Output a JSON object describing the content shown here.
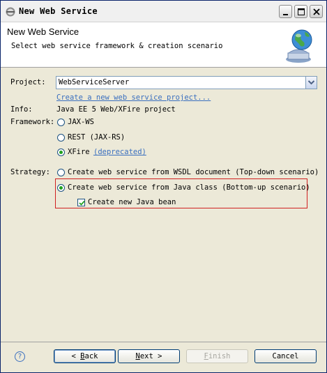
{
  "window": {
    "title": "New Web Service"
  },
  "header": {
    "title": "New Web Service",
    "description": "Select web service framework & creation scenario"
  },
  "form": {
    "project_label": "Project:",
    "project_value": "WebServiceServer",
    "create_project_link": "Create a new web service project...",
    "info_label": "Info:",
    "info_value": "Java EE 5 Web/XFire project",
    "framework_label": "Framework:",
    "frameworks": [
      {
        "label": "JAX-WS",
        "checked": false
      },
      {
        "label": "REST (JAX-RS)",
        "checked": false
      },
      {
        "label": "XFire",
        "checked": true,
        "note": "(deprecated)"
      }
    ],
    "strategy_label": "Strategy:",
    "strategies": [
      {
        "label": "Create web service from WSDL document (Top-down scenario)",
        "checked": false
      },
      {
        "label": "Create web service from Java class (Bottom-up scenario)",
        "checked": true
      }
    ],
    "create_bean_label": "Create new Java bean",
    "create_bean_checked": true
  },
  "buttons": {
    "help": "?",
    "back_prefix": "< ",
    "back_mnemonic": "B",
    "back_rest": "ack",
    "next_mnemonic": "N",
    "next_rest": "ext >",
    "finish_mnemonic": "F",
    "finish_rest": "inish",
    "cancel": "Cancel"
  },
  "colors": {
    "highlight_box": "#d02020",
    "link": "#3a6fbf",
    "radio_dot": "#21a121"
  }
}
